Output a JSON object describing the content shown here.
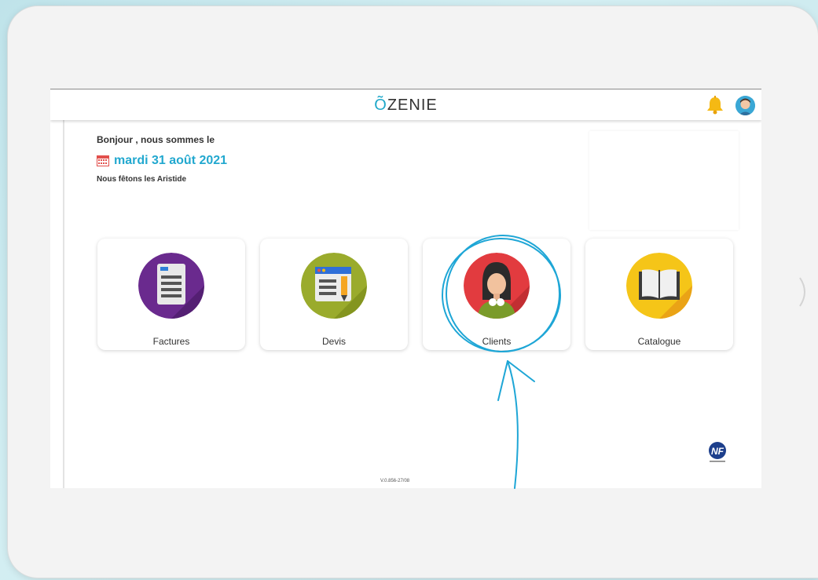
{
  "app": {
    "logo_prefix": "Õ",
    "logo_text": "ZENIE"
  },
  "header": {
    "icons": [
      "bell-icon",
      "user-avatar-icon"
    ]
  },
  "sidebar": {
    "toggle_label": "»"
  },
  "greeting": {
    "line1": "Bonjour , nous sommes le",
    "date": "mardi 31 août 2021",
    "fete": "Nous fêtons les Aristide"
  },
  "cards": [
    {
      "label": "Factures",
      "icon": "invoice-icon"
    },
    {
      "label": "Devis",
      "icon": "quote-icon"
    },
    {
      "label": "Clients",
      "icon": "client-icon"
    },
    {
      "label": "Catalogue",
      "icon": "catalogue-icon"
    }
  ],
  "footer": {
    "version": "V.0.856-27/08",
    "badge_text": "NF"
  },
  "colors": {
    "accent": "#22a8cf",
    "annotation": "#1ea6d6"
  }
}
